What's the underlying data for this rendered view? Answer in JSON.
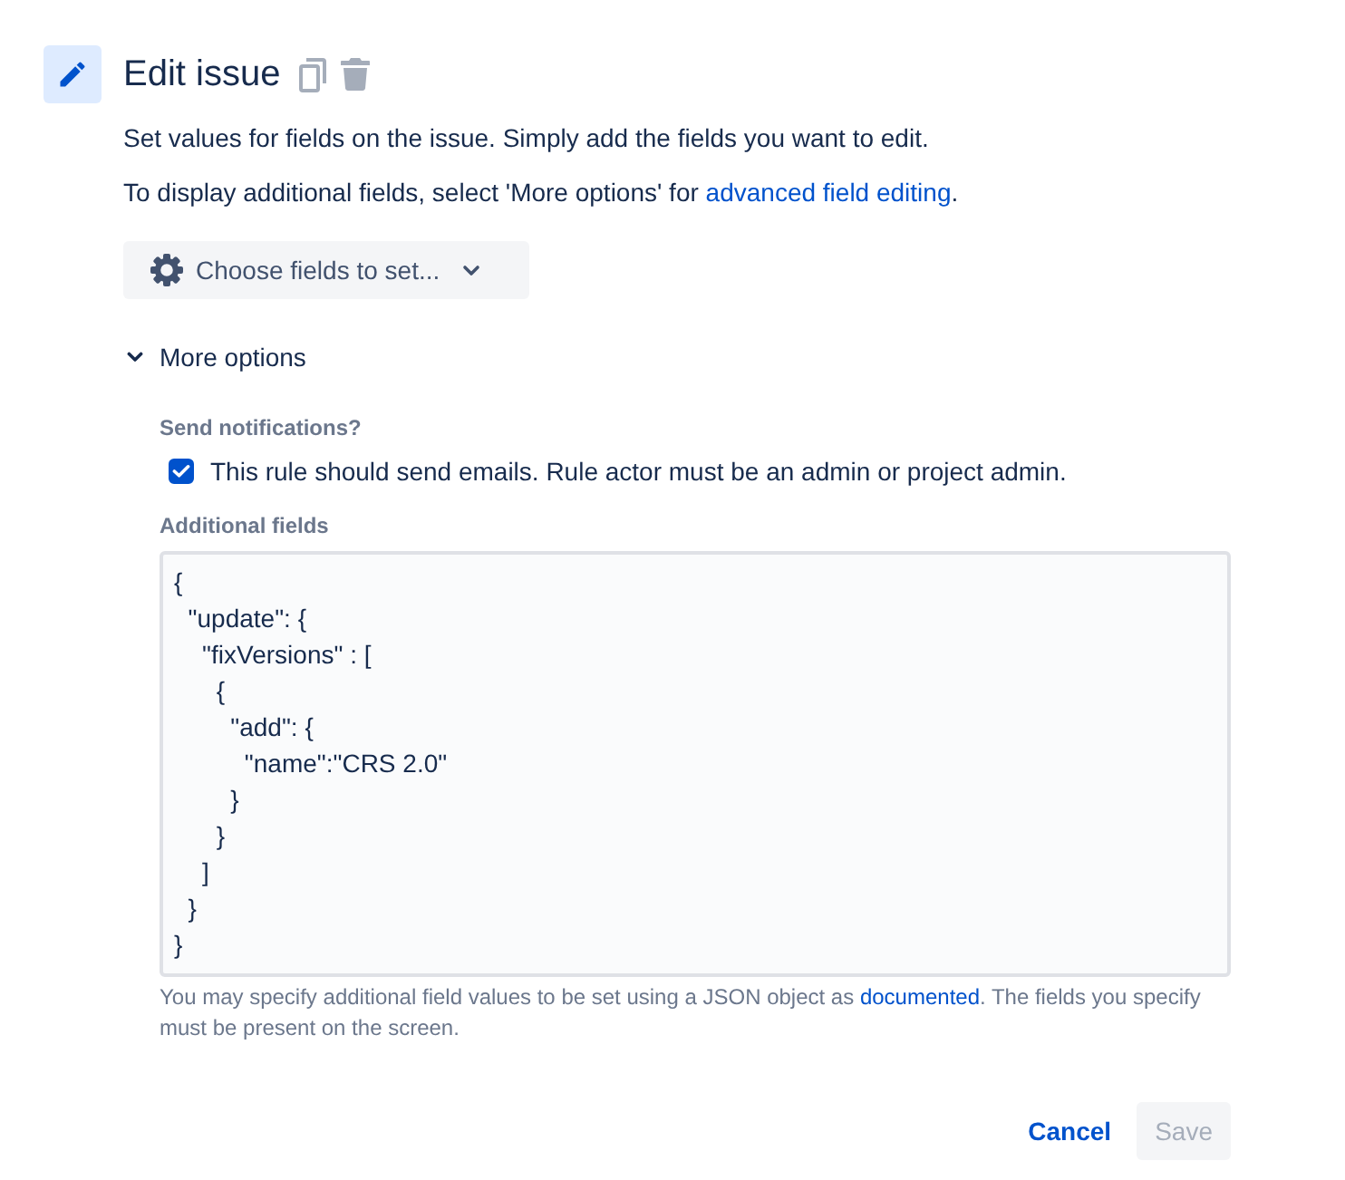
{
  "header": {
    "title": "Edit issue"
  },
  "description": "Set values for fields on the issue. Simply add the fields you want to edit.",
  "advanced_note": {
    "text_before": "To display additional fields, select 'More options' for ",
    "link": "advanced field editing",
    "text_after": "."
  },
  "field_picker": {
    "label": "Choose fields to set..."
  },
  "more_options": {
    "label": "More options",
    "expanded": true,
    "notifications": {
      "label": "Send notifications?",
      "checkbox": {
        "label": "This rule should send emails. Rule actor must be an admin or project admin.",
        "checked": true
      }
    },
    "additional_fields": {
      "label": "Additional fields",
      "value": "{\n  \"update\": {\n    \"fixVersions\" : [\n      {\n        \"add\": {\n          \"name\":\"CRS 2.0\"\n        }\n      }\n    ]\n  }\n}"
    },
    "help": {
      "text_before": "You may specify additional field values to be set using a JSON object as ",
      "link": "documented",
      "text_after": ". The fields you specify must be present on the screen."
    }
  },
  "actions": [
    {
      "label": "Cancel",
      "kind": "link",
      "disabled": false
    },
    {
      "label": "Save",
      "kind": "button",
      "disabled": true
    }
  ]
}
